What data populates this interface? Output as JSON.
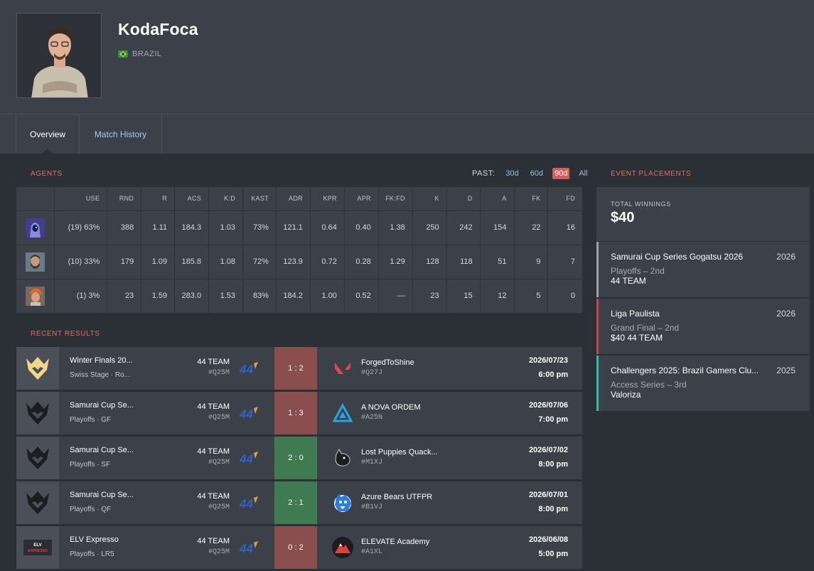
{
  "player": {
    "name": "KodaFoca",
    "country": "BRAZIL"
  },
  "tabs": [
    {
      "label": "Overview",
      "active": true
    },
    {
      "label": "Match History",
      "active": false
    }
  ],
  "agents": {
    "title": "AGENTS",
    "past_label": "PAST:",
    "periods": [
      "30d",
      "60d",
      "90d",
      "All"
    ],
    "active_period": "90d",
    "columns": [
      "",
      "USE",
      "RND",
      "R",
      "ACS",
      "K:D",
      "KAST",
      "ADR",
      "KPR",
      "APR",
      "FK:FD",
      "K",
      "D",
      "A",
      "FK",
      "FD"
    ],
    "rows": [
      {
        "agent_icon": "purple-hooded-agent-icon",
        "cells": [
          "(19) 63%",
          "388",
          "1.11",
          "184.3",
          "1.03",
          "73%",
          "121.1",
          "0.64",
          "0.40",
          "1.38",
          "250",
          "242",
          "154",
          "22",
          "16"
        ]
      },
      {
        "agent_icon": "bearded-agent-icon",
        "cells": [
          "(10) 33%",
          "179",
          "1.09",
          "185.8",
          "1.08",
          "72%",
          "123.9",
          "0.72",
          "0.28",
          "1.29",
          "128",
          "118",
          "51",
          "9",
          "7"
        ]
      },
      {
        "agent_icon": "orange-hair-agent-icon",
        "cells": [
          "(1) 3%",
          "23",
          "1.59",
          "283.0",
          "1.53",
          "83%",
          "184.2",
          "1.00",
          "0.52",
          "—",
          "23",
          "15",
          "12",
          "5",
          "0"
        ]
      }
    ]
  },
  "recent_results": {
    "title": "RECENT RESULTS",
    "matches": [
      {
        "event": "Winter Finals 20...",
        "stage": "Swiss Stage · Ro...",
        "event_logo": "gold-crown-logo",
        "team": "44 TEAM",
        "team_tag": "#Q25M",
        "score": "1 : 2",
        "result": "loss",
        "opponent": "ForgedToShine",
        "opponent_tag": "#Q27J",
        "opponent_logo": "valorant-logo",
        "date": "2026/07/23",
        "time": "6:00 pm"
      },
      {
        "event": "Samurai Cup Se...",
        "stage": "Playoffs · GF",
        "event_logo": "black-crown-logo",
        "team": "44 TEAM",
        "team_tag": "#Q25M",
        "score": "1 : 3",
        "result": "loss",
        "opponent": "A NOVA ORDEM",
        "opponent_tag": "#A25N",
        "opponent_logo": "blue-triangle-logo",
        "date": "2026/07/06",
        "time": "7:00 pm"
      },
      {
        "event": "Samurai Cup Se...",
        "stage": "Playoffs · SF",
        "event_logo": "black-crown-logo",
        "team": "44 TEAM",
        "team_tag": "#Q25M",
        "score": "2 : 0",
        "result": "win",
        "opponent": "Lost Puppies Quack...",
        "opponent_tag": "#M1XJ",
        "opponent_logo": "puppy-logo",
        "date": "2026/07/02",
        "time": "8:00 pm"
      },
      {
        "event": "Samurai Cup Se...",
        "stage": "Playoffs · QF",
        "event_logo": "black-crown-logo",
        "team": "44 TEAM",
        "team_tag": "#Q25M",
        "score": "2 : 1",
        "result": "win",
        "opponent": "Azure Bears UTFPR",
        "opponent_tag": "#B1VJ",
        "opponent_logo": "blue-bear-logo",
        "date": "2026/07/01",
        "time": "8:00 pm"
      },
      {
        "event": "ELV Expresso",
        "stage": "Playoffs · LR5",
        "event_logo": "elv-expresso-logo",
        "team": "44 TEAM",
        "team_tag": "#Q25M",
        "score": "0 : 2",
        "result": "loss",
        "opponent": "ELEVATE Academy",
        "opponent_tag": "#A1XL",
        "opponent_logo": "elevate-mountain-logo",
        "date": "2026/06/08",
        "time": "5:00 pm"
      }
    ]
  },
  "placements": {
    "title": "EVENT PLACEMENTS",
    "total_label": "TOTAL WINNINGS",
    "total_value": "$40",
    "events": [
      {
        "name": "Samurai Cup Series Gogatsu 2026",
        "year": "2026",
        "stage": "Playoffs – 2nd",
        "team": "44 TEAM",
        "color": "#9b9fa6"
      },
      {
        "name": "Liga Paulista",
        "year": "2026",
        "stage": "Grand Final – 2nd",
        "team": "$40 44 TEAM",
        "color": "#c94446"
      },
      {
        "name": "Challengers 2025: Brazil Gamers Clu...",
        "year": "2025",
        "stage": "Access Series – 3rd",
        "team": "Valoriza",
        "color": "#2fbfa0"
      }
    ]
  },
  "colors": {
    "accent": "#e96a66",
    "link": "#9fd0f0",
    "loss": "#8a4f4c",
    "win": "#3f7a50"
  }
}
